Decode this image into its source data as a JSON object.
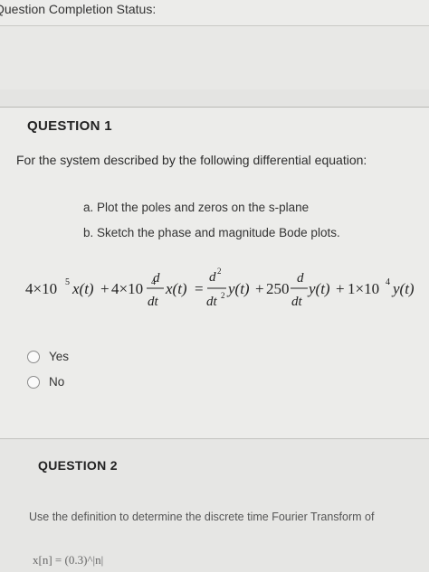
{
  "status": {
    "label": "Question Completion Status:"
  },
  "question1": {
    "title": "QUESTION 1",
    "prompt": "For the system described by the following differential equation:",
    "tasks": [
      "a. Plot the poles and zeros on the s-plane",
      "b. Sketch the phase and magnitude Bode plots."
    ],
    "equation": {
      "lhs_term1_coef": "4×10",
      "lhs_term1_exp": "5",
      "lhs_term1_var": "x(t)",
      "plus": "+",
      "lhs_term2_coef": "4×10",
      "lhs_term2_exp": "4",
      "d": "d",
      "dt": "dt",
      "lhs_term2_var": "x(t)",
      "equals": "=",
      "d2": "d",
      "d2_exp": "2",
      "dt2": "dt",
      "dt2_exp": "2",
      "rhs_term1_var": "y(t)",
      "rhs_term2_coef": "250",
      "rhs_term2_var": "y(t)",
      "rhs_term3_coef": "1×10",
      "rhs_term3_exp": "4",
      "rhs_term3_var": "y(t)"
    },
    "options": [
      {
        "label": "Yes",
        "selected": false
      },
      {
        "label": "No",
        "selected": false
      }
    ]
  },
  "question2": {
    "title": "QUESTION 2",
    "prompt": "Use the definition to determine the discrete time Fourier Transform of",
    "equation_fragment": "x[n] = (0.3)^|n|"
  }
}
